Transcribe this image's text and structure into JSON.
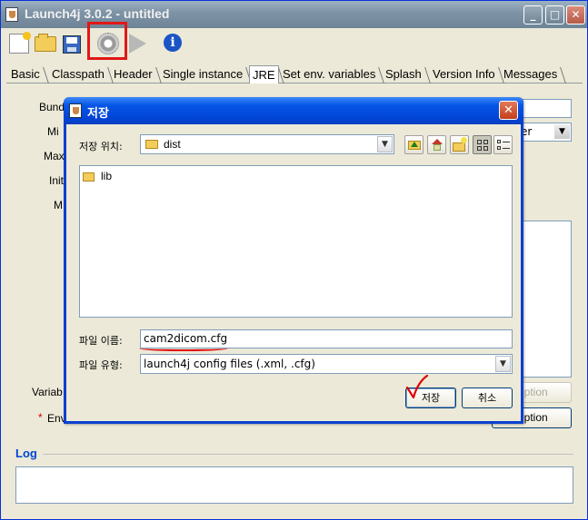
{
  "window": {
    "title": "Launch4j 3.0.2 - untitled",
    "buttons": {
      "minimize": "_",
      "maximize": "□",
      "close": "✕"
    }
  },
  "toolbar": {
    "icons": [
      "new-file-icon",
      "open-folder-icon",
      "save-disk-icon",
      "gear-build-icon",
      "run-arrow-icon",
      "info-icon"
    ],
    "info_glyph": "i",
    "highlight_color": "#e21717"
  },
  "tabs": [
    {
      "label": "Basic",
      "active": false
    },
    {
      "label": "Classpath",
      "active": false
    },
    {
      "label": "Header",
      "active": false
    },
    {
      "label": "Single instance",
      "active": false
    },
    {
      "label": "JRE",
      "active": true
    },
    {
      "label": "Set env. variables",
      "active": false
    },
    {
      "label": "Splash",
      "active": false
    },
    {
      "label": "Version Info",
      "active": false
    },
    {
      "label": "Messages",
      "active": false
    }
  ],
  "jre_panel": {
    "labels": [
      "Bund",
      "Mi",
      "Max",
      "Init",
      "M",
      "Variab",
      "Env"
    ],
    "required_marker": "*",
    "combo_visible_text": "er",
    "option_button_disabled": "Option",
    "option_button": "Option"
  },
  "log": {
    "heading": "Log",
    "content": ""
  },
  "dialog": {
    "title": "저장",
    "close": "✕",
    "look_in_label": "저장 위치:",
    "look_in_value": "dist",
    "files": [
      {
        "name": "lib",
        "type": "folder"
      }
    ],
    "file_name_label": "파일 이름:",
    "file_name_value": "cam2dicom.cfg",
    "file_type_label": "파일 유형:",
    "file_type_value": "launch4j config files (.xml, .cfg)",
    "save_button": "저장",
    "cancel_button": "취소",
    "annotation_color": "#e00000"
  }
}
